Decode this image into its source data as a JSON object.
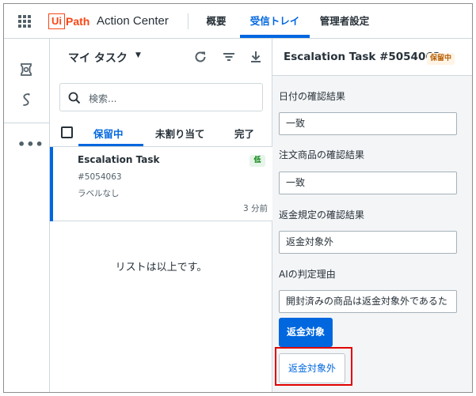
{
  "header": {
    "logo_box_text": "Ui",
    "logo_path_text": "Path",
    "app_title": "Action Center",
    "nav": [
      {
        "label": "概要",
        "active": false
      },
      {
        "label": "受信トレイ",
        "active": true
      },
      {
        "label": "管理者設定",
        "active": false
      }
    ]
  },
  "rail": {
    "icons": [
      "tasks-icon",
      "actions-icon"
    ],
    "more": "•••"
  },
  "task_list": {
    "title": "マイ タスク",
    "search_placeholder": "検索...",
    "tabs": [
      {
        "label": "保留中",
        "active": true
      },
      {
        "label": "未割り当て",
        "active": false
      },
      {
        "label": "完了",
        "active": false
      }
    ],
    "tasks": [
      {
        "name": "Escalation Task",
        "id": "#5054063",
        "label": "ラベルなし",
        "time": "3 分前",
        "priority": "低"
      }
    ],
    "end_text": "リストは以上です。"
  },
  "detail": {
    "title": "Escalation Task #5054063",
    "status": "保留中",
    "fields": [
      {
        "label": "日付の確認結果",
        "value": "一致"
      },
      {
        "label": "注文商品の確認結果",
        "value": "一致"
      },
      {
        "label": "返金規定の確認結果",
        "value": "返金対象外"
      },
      {
        "label": "AIの判定理由",
        "value": "開封済みの商品は返金対象外であるた"
      }
    ],
    "primary_button": "返金対象",
    "secondary_button": "返金対象外"
  },
  "colors": {
    "accent": "#0067df",
    "brand": "#fa4616",
    "highlight": "#e00000"
  }
}
